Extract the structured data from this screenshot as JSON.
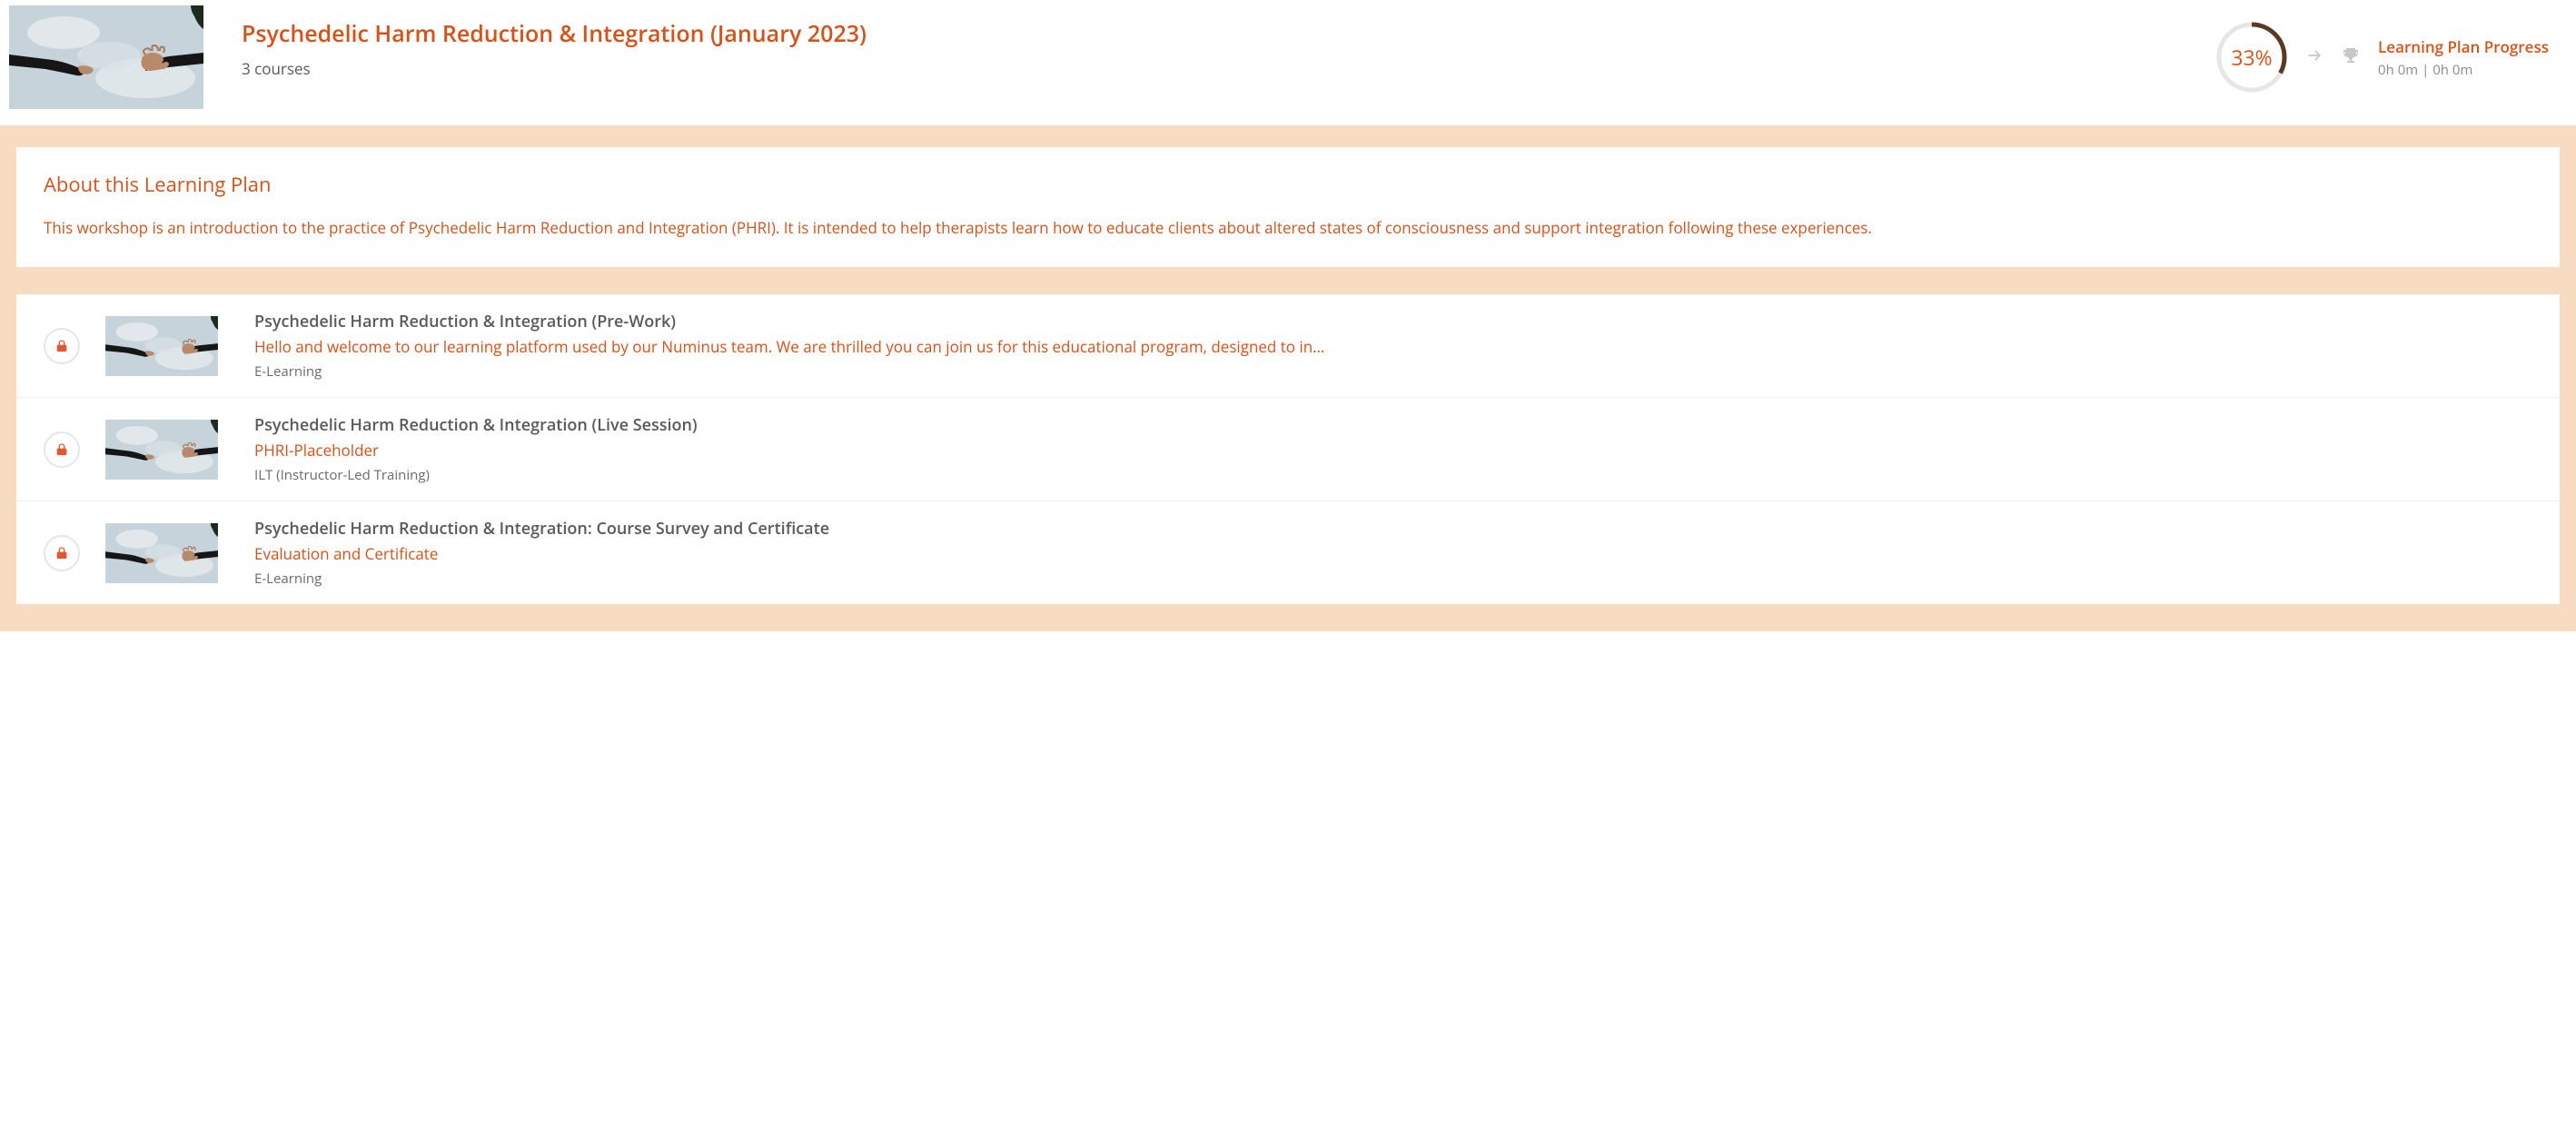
{
  "header": {
    "title": "Psychedelic Harm Reduction & Integration (January 2023)",
    "subtitle": "3 courses"
  },
  "progress": {
    "percent_label": "33%",
    "percent_value": 33,
    "title": "Learning Plan Progress",
    "time": "0h 0m | 0h 0m"
  },
  "about": {
    "heading": "About this Learning Plan",
    "description": "This workshop is an introduction to the practice of Psychedelic Harm Reduction and Integration (PHRI). It is intended to help therapists learn how to educate clients about altered states of consciousness and support integration following these experiences."
  },
  "courses": [
    {
      "title": "Psychedelic Harm Reduction & Integration (Pre-Work)",
      "description": "Hello and welcome to our learning platform used by our Numinus team. We are thrilled you can join us for this educational program, designed to in…",
      "type": "E-Learning"
    },
    {
      "title": "Psychedelic Harm Reduction & Integration (Live Session)",
      "description": "PHRI-Placeholder",
      "type": "ILT (Instructor-Led Training)"
    },
    {
      "title": "Psychedelic Harm Reduction & Integration: Course Survey and Certificate",
      "description": "Evaluation and Certificate",
      "type": "E-Learning"
    }
  ]
}
